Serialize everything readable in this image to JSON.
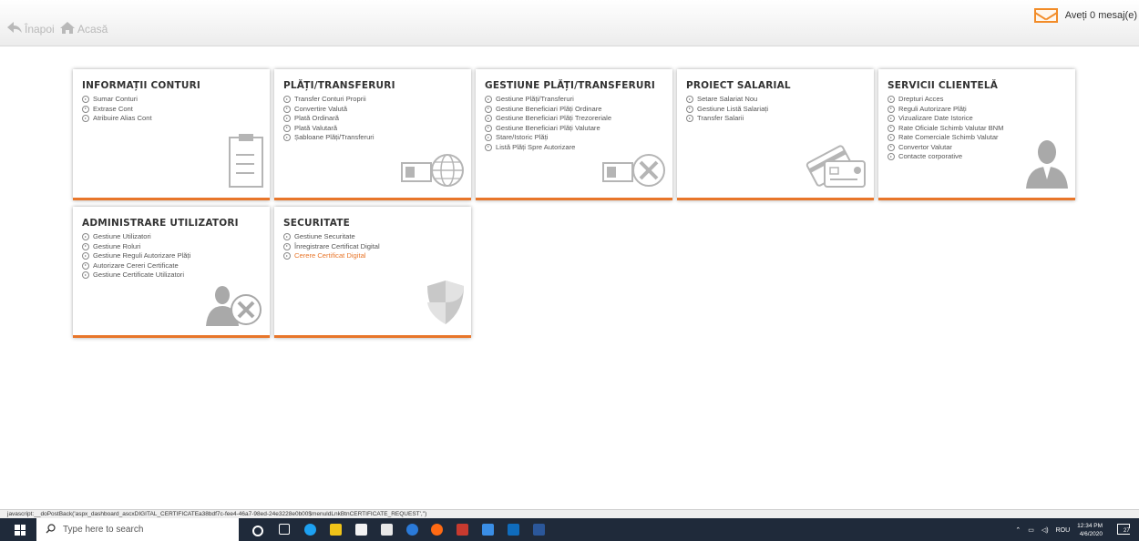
{
  "topbar": {
    "back_label": "Înapoi",
    "home_label": "Acasă",
    "messages_label": "Aveți 0 mesaj(e)"
  },
  "cards": [
    {
      "title": "INFORMAȚII CONTURI",
      "links": [
        "Sumar Conturi",
        "Extrase Cont",
        "Atribuire Alias Cont"
      ],
      "icon": "clipboard-icon"
    },
    {
      "title": "PLĂȚI/TRANSFERURI",
      "links": [
        "Transfer Conturi Proprii",
        "Convertire Valută",
        "Plată Ordinară",
        "Plată Valutară",
        "Șabloane Plăți/Transferuri"
      ],
      "icon": "money-globe-icon"
    },
    {
      "title": "GESTIUNE PLĂȚI/TRANSFERURI",
      "links": [
        "Gestiune Plăți/Transferuri",
        "Gestiune Beneficiari Plăți Ordinare",
        "Gestiune Beneficiari Plăți Trezoreriale",
        "Gestiune Beneficiari Plăți Valutare",
        "Stare/Istoric Plăți",
        "Listă Plăți Spre Autorizare"
      ],
      "icon": "money-tools-icon"
    },
    {
      "title": "PROIECT SALARIAL",
      "links": [
        "Setare Salariat Nou",
        "Gestiune Listă Salariați",
        "Transfer Salarii"
      ],
      "icon": "cards-icon"
    },
    {
      "title": "SERVICII CLIENTELĂ",
      "links": [
        "Drepturi Acces",
        "Reguli Autorizare Plăți",
        "Vizualizare Date Istorice",
        "Rate Oficiale Schimb Valutar BNM",
        "Rate Comerciale Schimb Valutar",
        "Convertor Valutar",
        "Contacte corporative"
      ],
      "icon": "person-icon"
    },
    {
      "title": "ADMINISTRARE UTILIZATORI",
      "links": [
        "Gestiune Utilizatori",
        "Gestiune Roluri",
        "Gestiune Reguli Autorizare Plăți",
        "Autorizare Cereri Certificate",
        "Gestiune Certificate Utilizatori"
      ],
      "icon": "user-tools-icon"
    },
    {
      "title": "SECURITATE",
      "links": [
        "Gestiune Securitate",
        "Înregistrare Certificat Digital",
        "Cerere Certificat Digital"
      ],
      "active_link": 2,
      "icon": "shield-icon"
    }
  ],
  "statusbar": {
    "text": "javascript:__doPostBack('aspx_dashboard_ascxDIGITAL_CERTIFICATEa38bdf7c-fee4-46a7-98ed-24e3228e0b00$menuldLnkBtnCERTIFICATE_REQUEST','')"
  },
  "taskbar": {
    "search_placeholder": "Type here to search",
    "language": "ROU",
    "time": "12:34 PM",
    "date": "4/6/2020",
    "notification_count": "27"
  },
  "colors": {
    "accent": "#e8762a",
    "taskbar": "#1f2a3a"
  }
}
